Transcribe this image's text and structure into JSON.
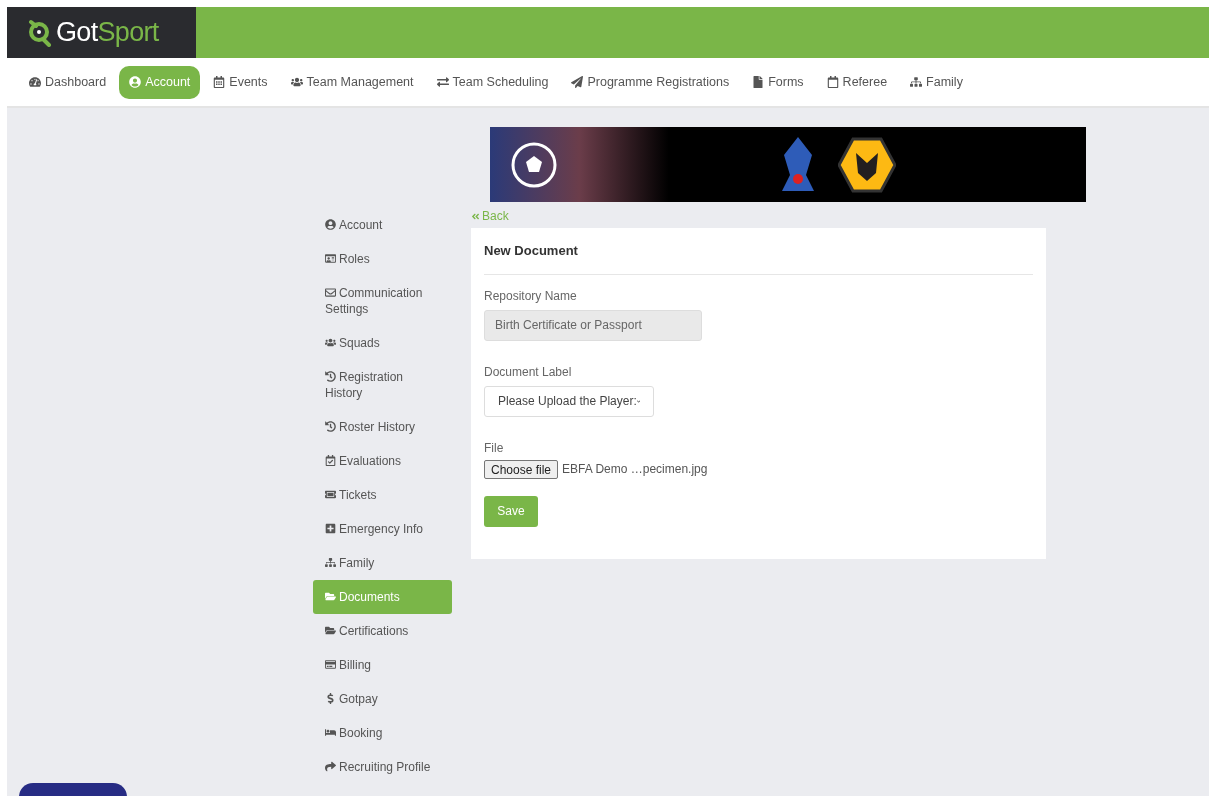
{
  "logo": {
    "first": "Got",
    "second": "Sport"
  },
  "nav": [
    {
      "label": "Dashboard",
      "selected": false
    },
    {
      "label": "Account",
      "selected": true
    },
    {
      "label": "Events",
      "selected": false
    },
    {
      "label": "Team Management",
      "selected": false
    },
    {
      "label": "Team Scheduling",
      "selected": false
    },
    {
      "label": "Programme Registrations",
      "selected": false
    },
    {
      "label": "Forms",
      "selected": false
    },
    {
      "label": "Referee",
      "selected": false
    },
    {
      "label": "Family",
      "selected": false
    }
  ],
  "sidebar": {
    "items": [
      {
        "label": "Account",
        "selected": false
      },
      {
        "label": "Roles",
        "selected": false
      },
      {
        "label": "Communication Settings",
        "selected": false
      },
      {
        "label": "Squads",
        "selected": false
      },
      {
        "label": "Registration History",
        "selected": false
      },
      {
        "label": "Roster History",
        "selected": false
      },
      {
        "label": "Evaluations",
        "selected": false
      },
      {
        "label": "Tickets",
        "selected": false
      },
      {
        "label": "Emergency Info",
        "selected": false
      },
      {
        "label": "Family",
        "selected": false
      },
      {
        "label": "Documents",
        "selected": true
      },
      {
        "label": "Certifications",
        "selected": false
      },
      {
        "label": "Billing",
        "selected": false
      },
      {
        "label": "Gotpay",
        "selected": false
      },
      {
        "label": "Booking",
        "selected": false
      },
      {
        "label": "Recruiting Profile",
        "selected": false
      }
    ]
  },
  "back_link": "Back",
  "form": {
    "title": "New Document",
    "fields": [
      {
        "kind": "text",
        "label": "Repository Name",
        "value": "Birth Certificate or Passport",
        "disabled": true
      },
      {
        "kind": "select",
        "label": "Document Label",
        "value": "Please Upload the Player:"
      },
      {
        "kind": "file",
        "label": "File",
        "button": "Choose file",
        "value": "EBFA Demo …pecimen.jpg"
      }
    ],
    "submit": "Save"
  }
}
